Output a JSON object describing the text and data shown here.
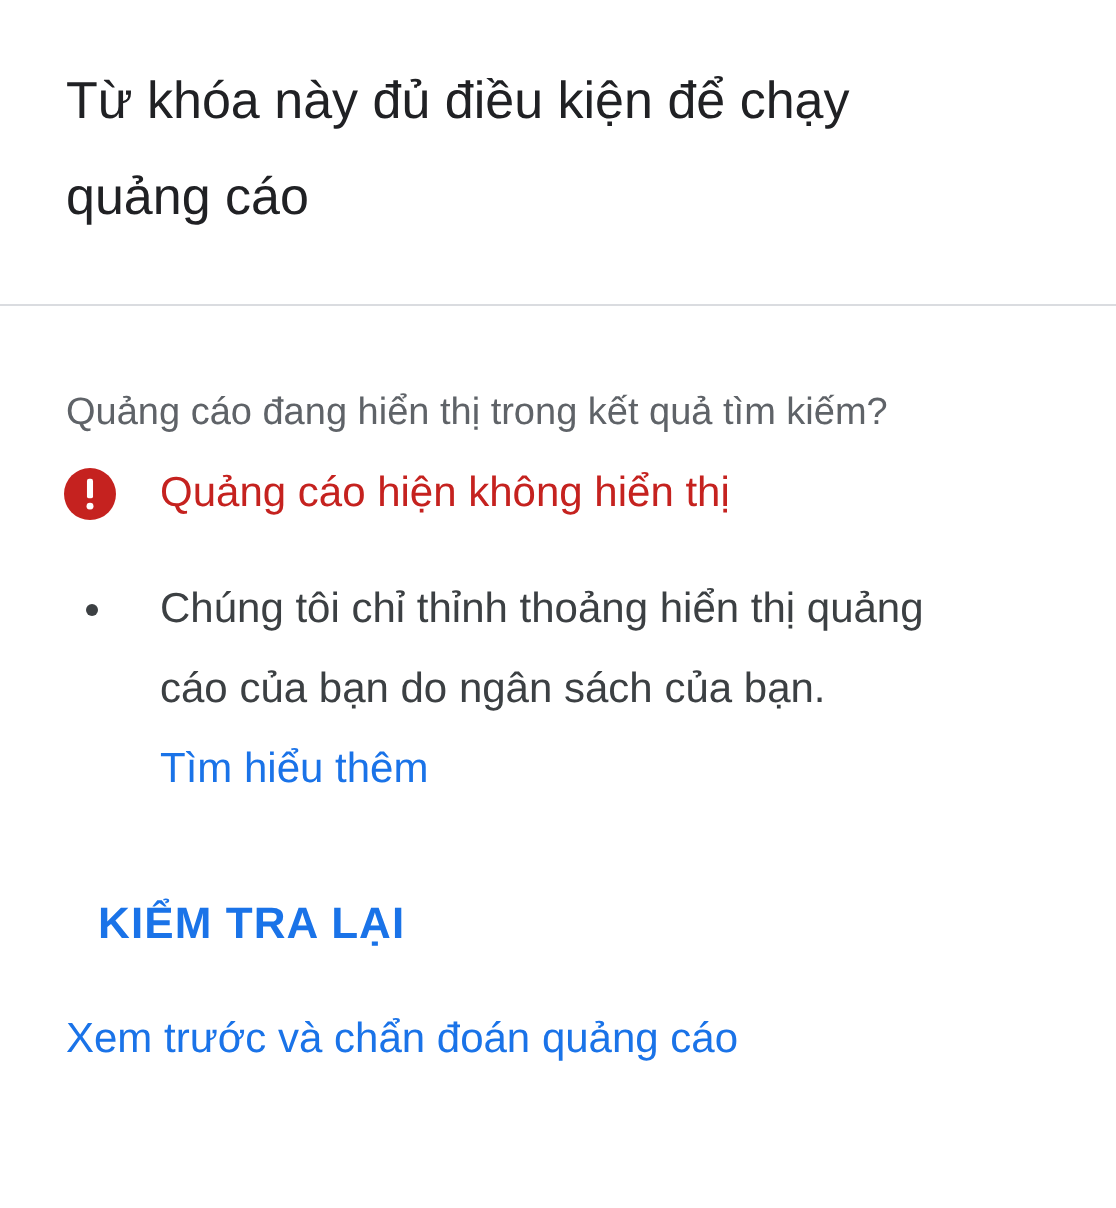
{
  "title": "Từ khóa này đủ điều kiện để chạy quảng cáo",
  "question": "Quảng cáo đang hiển thị trong kết quả tìm kiếm?",
  "status": {
    "kind": "error",
    "text": "Quảng cáo hiện không hiển thị"
  },
  "reasons": [
    {
      "text": "Chúng tôi chỉ thỉnh thoảng hiển thị quảng cáo của bạn do ngân sách của bạn.",
      "link": "Tìm hiểu thêm"
    }
  ],
  "recheck_button": "KIỂM TRA LẠI",
  "preview_link": "Xem trước và chẩn đoán quảng cáo"
}
